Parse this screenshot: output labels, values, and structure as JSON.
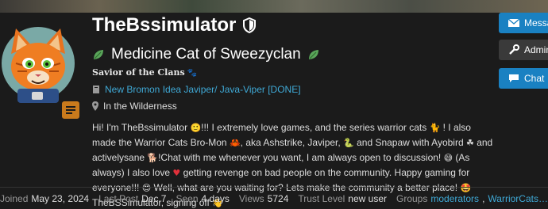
{
  "profile": {
    "username": "TheBssimulator",
    "title": "Medicine Cat of Sweezyclan",
    "flair": "Savior of the Clans",
    "featured_topic": "New Bromon Idea Javiper/ Java-Viper [DONE]",
    "location": "In the Wilderness",
    "bio": {
      "p1": "Hi! I'm TheBssimulator ",
      "p2": "!!! I extremely love games, and the series warrior cats ",
      "p3": " ! I also made the Warrior Cats Bro-Mon ",
      "p4": ", aka Ashstrike, Javiper, ",
      "p5": " and Snapaw with Ayobird ",
      "p6": " and activelysane ",
      "p7": "!Chat with me whenever you want, I am always open to discussion! ",
      "p8": " (As always) I also love ",
      "p9": " getting revenge on bad people on the community. Happy gaming for everyone!!! ",
      "p10": " Well, what are you waiting for? Lets make the community a better place! ",
      "p11": "TheBSSimulator, signing off "
    }
  },
  "actions": {
    "message": "Message",
    "admin": "Admin",
    "chat": "Chat"
  },
  "stats": {
    "joined_label": "Joined",
    "joined_value": "May 23, 2024",
    "last_post_label": "Last Post",
    "last_post_value": "Dec 7",
    "seen_label": "Seen",
    "seen_value": "4 days",
    "views_label": "Views",
    "views_value": "5724",
    "trust_label": "Trust Level",
    "trust_value": "new user",
    "groups_label": "Groups",
    "group1": "moderators",
    "group2": "WarriorCats…"
  },
  "icons": {
    "leaf_color": "#5aa55a",
    "badge_color": "#c97a1c",
    "link_color": "#3fa9d6",
    "accent_button": "#1a81c2"
  }
}
